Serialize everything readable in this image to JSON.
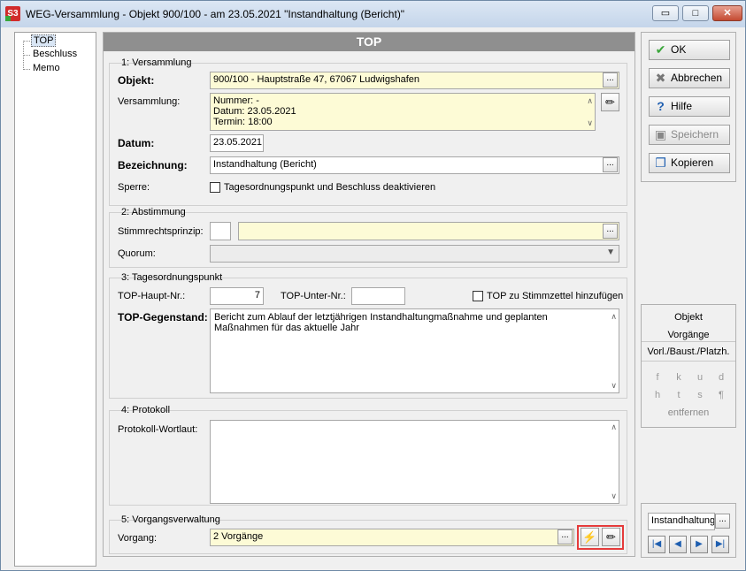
{
  "window": {
    "title": "WEG-Versammlung - Objekt 900/100 - am 23.05.2021 \"Instandhaltung (Bericht)\"",
    "app_icon_text": "S3",
    "minimize": "▭",
    "maximize": "□",
    "close": "✕"
  },
  "tree": {
    "items": [
      {
        "label": "TOP",
        "selected": true
      },
      {
        "label": "Beschluss"
      },
      {
        "label": "Memo"
      }
    ]
  },
  "form": {
    "header": "TOP",
    "versammlung": {
      "title": "1: Versammlung",
      "objekt_label": "Objekt:",
      "objekt_value": "900/100 - Hauptstraße 47, 67067 Ludwigshafen",
      "versammlung_label": "Versammlung:",
      "versammlung_lines": [
        "Nummer: -",
        "Datum: 23.05.2021",
        "Termin: 18:00"
      ],
      "datum_label": "Datum:",
      "datum_value": "23.05.2021",
      "bezeichnung_label": "Bezeichnung:",
      "bezeichnung_value": "Instandhaltung (Bericht)",
      "sperre_label": "Sperre:",
      "sperre_checkbox_label": "Tagesordnungspunkt und Beschluss deaktivieren"
    },
    "abstimmung": {
      "title": "2: Abstimmung",
      "stimmrecht_label": "Stimmrechtsprinzip:",
      "quorum_label": "Quorum:"
    },
    "tagesordnungspunkt": {
      "title": "3: Tagesordnungspunkt",
      "haupt_label": "TOP-Haupt-Nr.:",
      "haupt_value": "7",
      "unter_label": "TOP-Unter-Nr.:",
      "stimmzettel_label": "TOP zu Stimmzettel hinzufügen",
      "gegenstand_label": "TOP-Gegenstand:",
      "gegenstand_value": "Bericht zum Ablauf der letztjährigen Instandhaltungmaßnahme und geplanten Maßnahmen für das aktuelle Jahr"
    },
    "protokoll": {
      "title": "4: Protokoll",
      "wortlaut_label": "Protokoll-Wortlaut:"
    },
    "vorgang": {
      "title": "5: Vorgangsverwaltung",
      "vorgang_label": "Vorgang:",
      "vorgang_value": "2 Vorgänge"
    },
    "dots": "..."
  },
  "buttons": {
    "ok": "OK",
    "abbrechen": "Abbrechen",
    "hilfe": "Hilfe",
    "speichern": "Speichern",
    "kopieren": "Kopieren"
  },
  "side": {
    "objekt": "Objekt",
    "vorgaenge": "Vorgänge",
    "vorl": "Vorl./Baust./Platzh.",
    "fmt_row1": [
      "f",
      "k",
      "u",
      "d"
    ],
    "fmt_row2": [
      "h",
      "t",
      "s",
      "¶"
    ],
    "entfernen": "entfernen"
  },
  "nav": {
    "field_value": "Instandhaltung",
    "first": "|◀",
    "prev": "◀",
    "next": "▶",
    "last": "▶|"
  },
  "colors": {
    "header_bg": "#8f8f8f",
    "field_yellow": "#fdfbd6",
    "highlight": "#e53b3b"
  }
}
